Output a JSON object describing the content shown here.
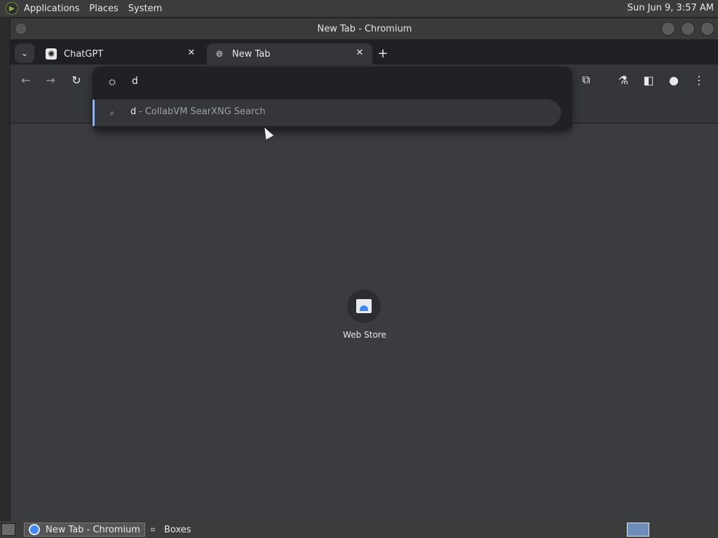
{
  "top_panel": {
    "menus": [
      "Applications",
      "Places",
      "System"
    ],
    "clock": "Sun Jun  9,  3:57 AM"
  },
  "window": {
    "title": "New Tab - Chromium"
  },
  "tabs": [
    {
      "label": "ChatGPT",
      "icon": "openai-icon"
    },
    {
      "label": "New Tab",
      "icon": "globe-icon"
    }
  ],
  "omnibox": {
    "value": "d",
    "suggestion": {
      "query": "d",
      "description": " - CollabVM SearXNG Search"
    }
  },
  "new_tab_page": {
    "shortcut_label": "Web Store"
  },
  "taskbar": {
    "tasks": [
      {
        "label": "New Tab - Chromium"
      },
      {
        "label": "Boxes"
      }
    ]
  },
  "colors": {
    "accent": "#8ab4f8",
    "content_bg": "#3b3c40",
    "tab_active": "#35363a"
  }
}
